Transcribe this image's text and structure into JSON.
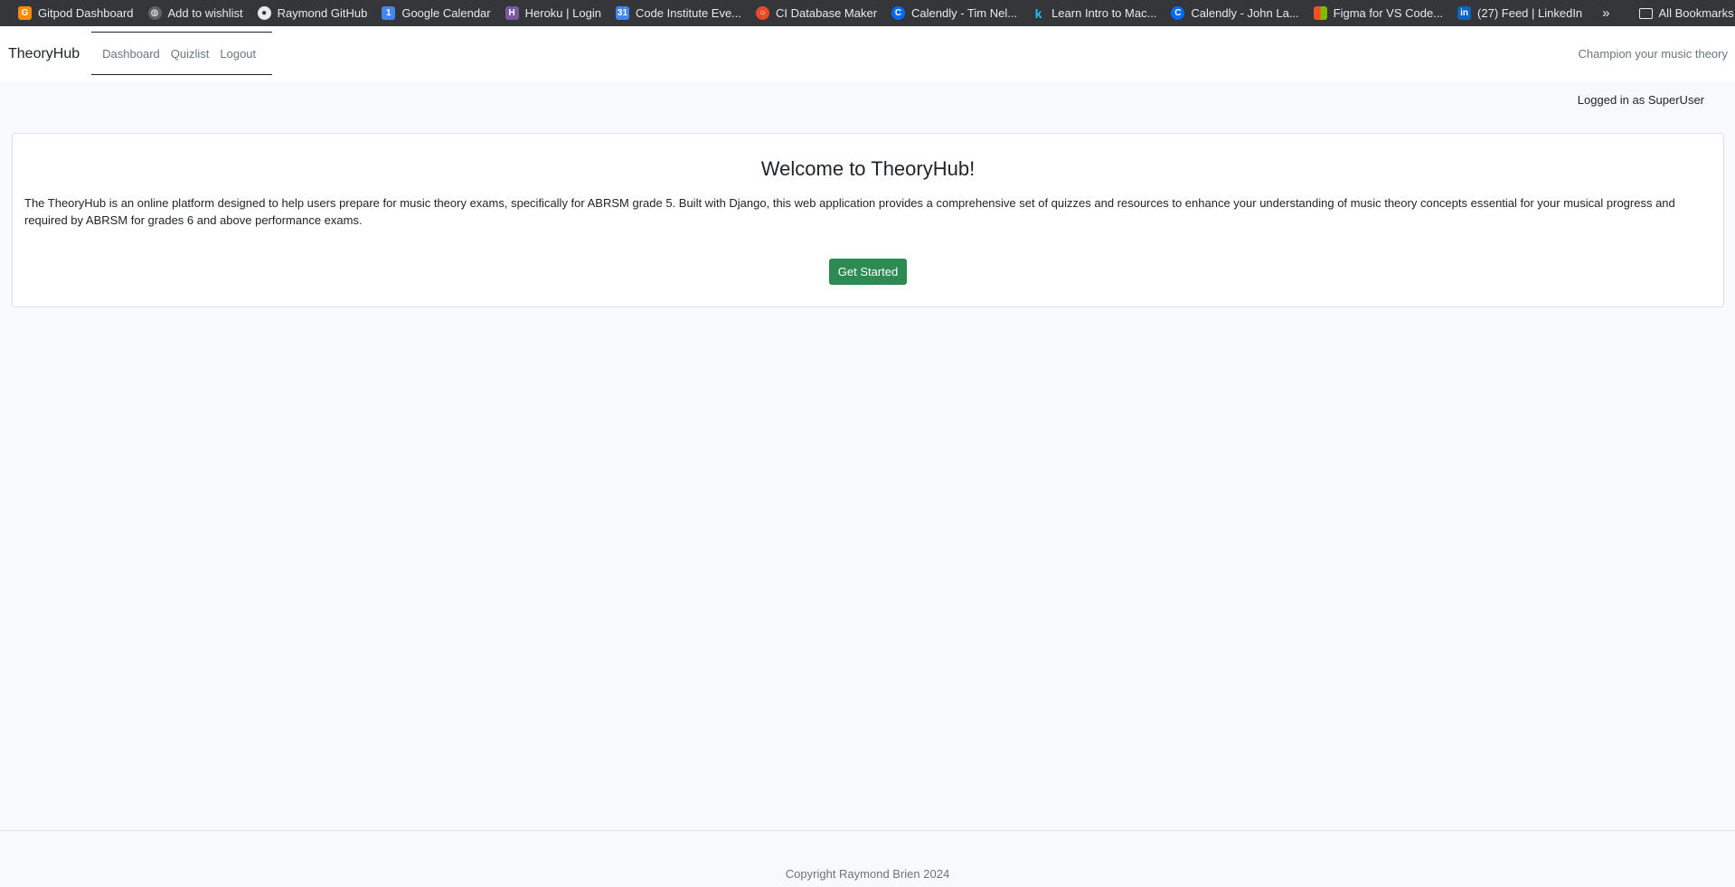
{
  "bookmarks": {
    "items": [
      {
        "label": "Gitpod Dashboard",
        "icon": "gitpod-icon",
        "color": "#ff8a00"
      },
      {
        "label": "Add to wishlist",
        "icon": "globe-icon",
        "color": "#9aa0a6"
      },
      {
        "label": "Raymond GitHub",
        "icon": "github-icon",
        "color": "#e8eaed"
      },
      {
        "label": "Google Calendar",
        "icon": "calendar-icon",
        "color": "#4285f4"
      },
      {
        "label": "Heroku | Login",
        "icon": "heroku-icon",
        "color": "#79589f"
      },
      {
        "label": "Code Institute Eve...",
        "icon": "calendar-icon",
        "color": "#4285f4"
      },
      {
        "label": "CI Database Maker",
        "icon": "ci-icon",
        "color": "#e84a27"
      },
      {
        "label": "Calendly - Tim Nel...",
        "icon": "calendly-icon",
        "color": "#006bff"
      },
      {
        "label": "Learn Intro to Mac...",
        "icon": "kaggle-icon",
        "color": "#20beff"
      },
      {
        "label": "Calendly - John La...",
        "icon": "calendly-icon",
        "color": "#006bff"
      },
      {
        "label": "Figma for VS Code...",
        "icon": "microsoft-icon",
        "color": "#f25022"
      },
      {
        "label": "(27) Feed | LinkedIn",
        "icon": "linkedin-icon",
        "color": "#0a66c2"
      }
    ],
    "more_label": "»",
    "all_bookmarks_label": "All Bookmarks"
  },
  "navbar": {
    "brand": "TheoryHub",
    "links": [
      "Dashboard",
      "Quizlist",
      "Logout"
    ],
    "tagline": "Champion your music theory"
  },
  "status": {
    "logged_in": "Logged in as SuperUser"
  },
  "card": {
    "title": "Welcome to TheoryHub!",
    "text": "The TheoryHub is an online platform designed to help users prepare for music theory exams, specifically for ABRSM grade 5. Built with Django, this web application provides a comprehensive set of quizzes and resources to enhance your understanding of music theory concepts essential for your musical progress and required by ABRSM for grades 6 and above performance exams.",
    "button_label": "Get Started"
  },
  "footer": {
    "text": "Copyright Raymond Brien 2024"
  },
  "colors": {
    "accent_green": "#2d8a52",
    "background": "#f8f9fa",
    "muted_text": "#6c757d"
  }
}
